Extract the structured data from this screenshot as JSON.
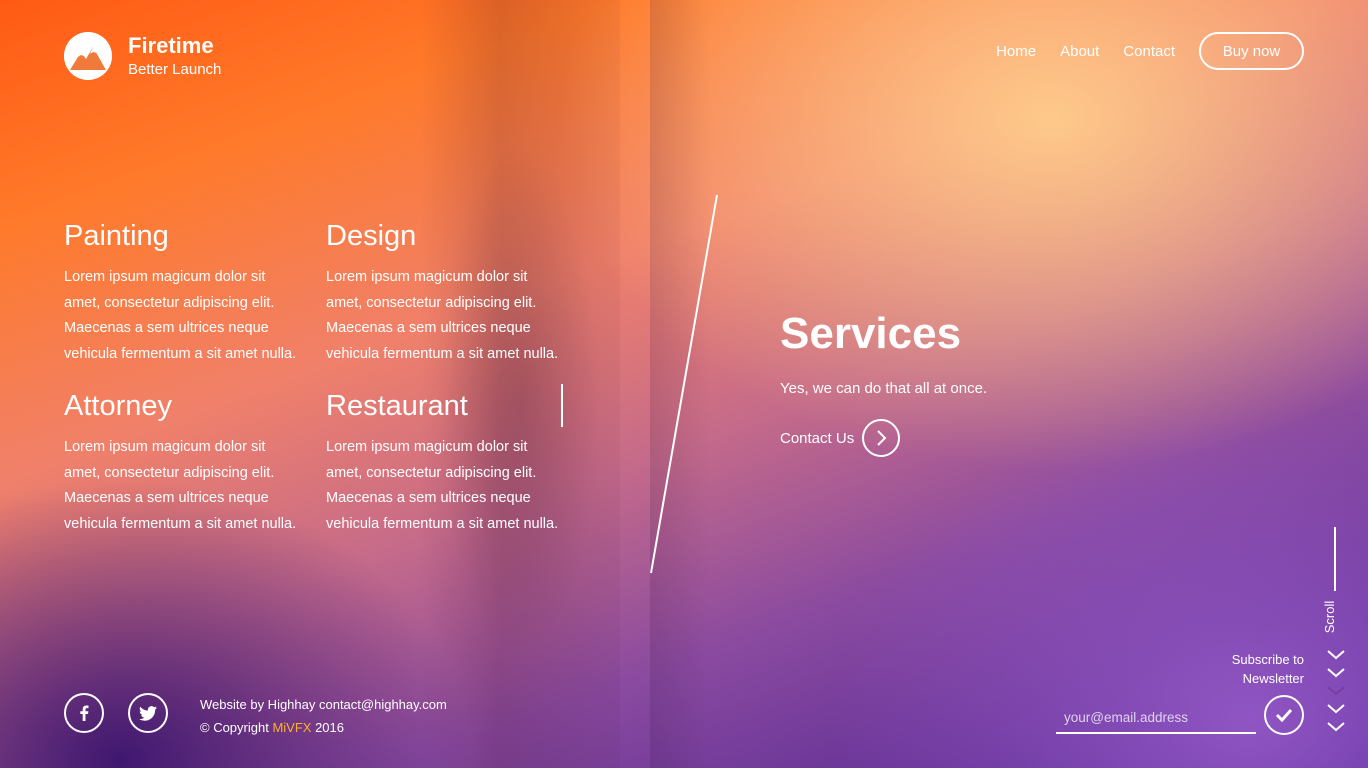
{
  "header": {
    "brand_name": "Firetime",
    "brand_tagline": "Better Launch",
    "nav": [
      "Home",
      "About",
      "Contact"
    ],
    "buy_label": "Buy now"
  },
  "services_grid": [
    {
      "title": "Painting",
      "text": "Lorem ipsum magicum dolor sit amet, consectetur adipiscing elit. Maecenas a sem ultrices neque vehicula fermentum a sit amet nulla."
    },
    {
      "title": "Design",
      "text": "Lorem ipsum magicum dolor sit amet, consectetur adipiscing elit. Maecenas a sem ultrices neque vehicula fermentum a sit amet nulla."
    },
    {
      "title": "Attorney",
      "text": "Lorem ipsum magicum dolor sit amet, consectetur adipiscing elit. Maecenas a sem ultrices neque vehicula fermentum a sit amet nulla."
    },
    {
      "title": "Restaurant",
      "text": "Lorem ipsum magicum dolor sit amet, consectetur adipiscing elit. Maecenas a sem ultrices neque vehicula fermentum a sit amet nulla."
    }
  ],
  "hero": {
    "title": "Services",
    "subtitle": "Yes, we can do that all at once.",
    "contact_label": "Contact Us"
  },
  "footer": {
    "credit_line": "Website by Highhay contact@highhay.com",
    "copyright_prefix": "© Copyright ",
    "copyright_brand": "MiVFX",
    "copyright_year": " 2016",
    "subscribe_line1": "Subscribe to",
    "subscribe_line2": "Newsletter",
    "email_placeholder": "your@email.address",
    "scroll_label": "Scroll"
  },
  "icons": {
    "logo": "mountain-logo-icon",
    "facebook": "facebook-icon",
    "twitter": "twitter-icon",
    "arrow": "chevron-right-icon",
    "check": "checkmark-icon",
    "scroll": "chevron-down-icon"
  },
  "colors": {
    "accent": "#ffb02e",
    "text": "#ffffff"
  }
}
